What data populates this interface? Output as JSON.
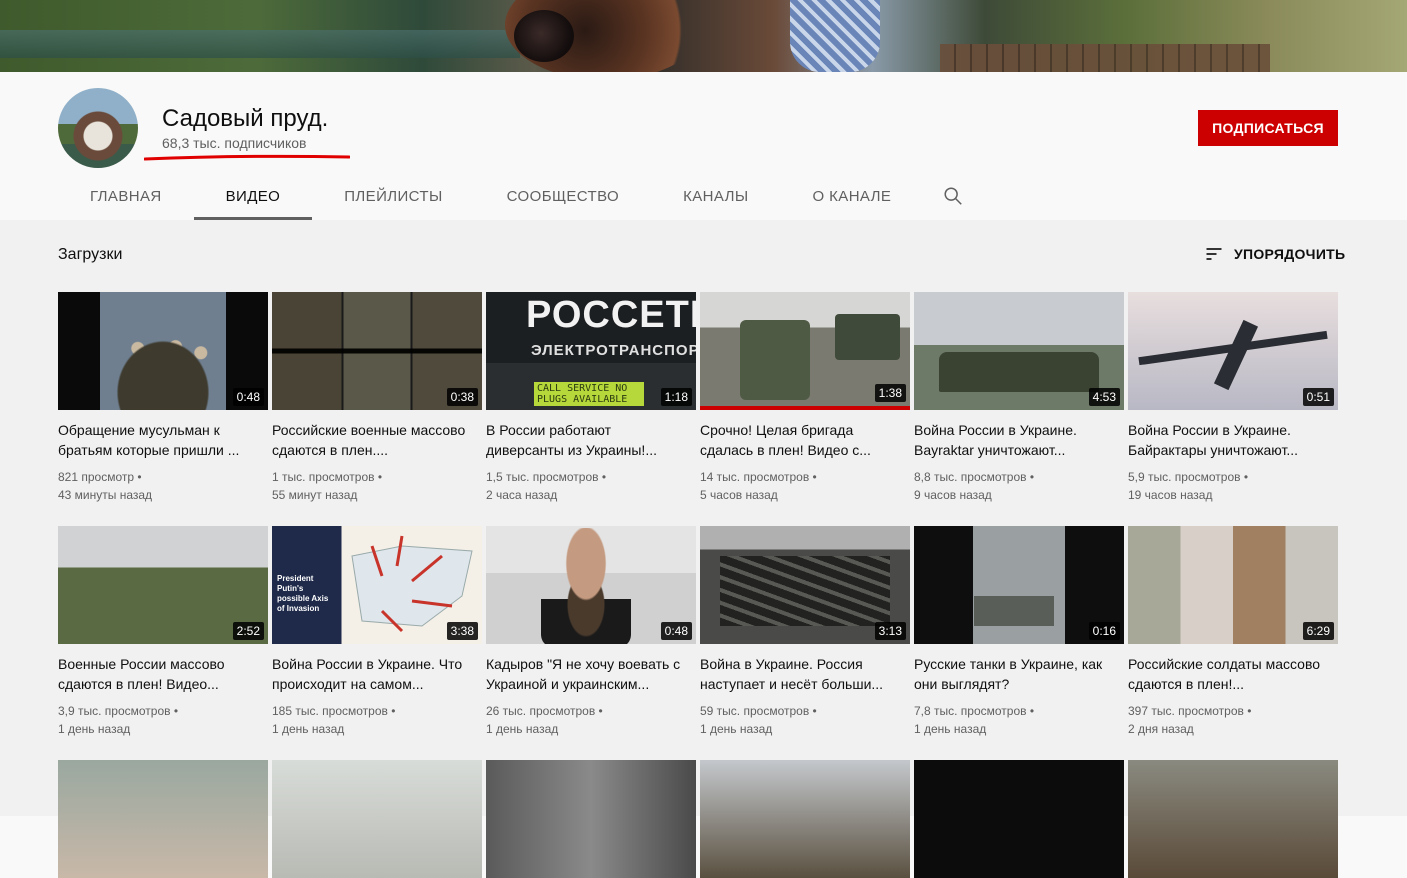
{
  "channel": {
    "name": "Садовый пруд.",
    "subscribers": "68,3 тыс. подписчиков",
    "subscribe_label": "ПОДПИСАТЬСЯ",
    "accent_color": "#cc0000"
  },
  "tabs": [
    {
      "label": "ГЛАВНАЯ"
    },
    {
      "label": "ВИДЕО",
      "active": true
    },
    {
      "label": "ПЛЕЙЛИСТЫ"
    },
    {
      "label": "СООБЩЕСТВО"
    },
    {
      "label": "КАНАЛЫ"
    },
    {
      "label": "О КАНАЛЕ"
    }
  ],
  "section": {
    "title": "Загрузки",
    "sort_label": "УПОРЯДОЧИТЬ"
  },
  "thumb_text": {
    "v3_big": "РОССЕТИ",
    "v3_small": "ЭЛЕКТРОТРАНСПОРТ",
    "v3_lcd": "CALL SERVICE NO PLUGS AVAILABLE",
    "v8_label": "President Putin's possible Axis of Invasion"
  },
  "videos": [
    {
      "title": "Обращение мусульман к братьям которые пришли ...",
      "duration": "0:48",
      "views": "821 просмотр •",
      "age": "43 минуты назад"
    },
    {
      "title": "Российские военные массово сдаются в плен....",
      "duration": "0:38",
      "views": "1 тыс. просмотров •",
      "age": "55 минут назад"
    },
    {
      "title": "В России работают диверсанты из Украины!...",
      "duration": "1:18",
      "views": "1,5 тыс. просмотров •",
      "age": "2 часа назад"
    },
    {
      "title": "Срочно! Целая бригада сдалась в плен! Видео с...",
      "duration": "1:38",
      "views": "14 тыс. просмотров •",
      "age": "5 часов назад",
      "watched_fraction": 1.0
    },
    {
      "title": "Война России в Украине. Bayraktar уничтожают...",
      "duration": "4:53",
      "views": "8,8 тыс. просмотров •",
      "age": "9 часов назад"
    },
    {
      "title": "Война России в Украине. Байрактары уничтожают...",
      "duration": "0:51",
      "views": "5,9 тыс. просмотров •",
      "age": "19 часов назад"
    },
    {
      "title": "Военные России массово сдаются в плен! Видео...",
      "duration": "2:52",
      "views": "3,9 тыс. просмотров •",
      "age": "1 день назад"
    },
    {
      "title": "Война России в Украине. Что происходит на самом...",
      "duration": "3:38",
      "views": "185 тыс. просмотров •",
      "age": "1 день назад"
    },
    {
      "title": "Кадыров \"Я не хочу воевать с Украиной и украинским...",
      "duration": "0:48",
      "views": "26 тыс. просмотров •",
      "age": "1 день назад"
    },
    {
      "title": "Война в Украине. Россия наступает и несёт больши...",
      "duration": "3:13",
      "views": "59 тыс. просмотров •",
      "age": "1 день назад"
    },
    {
      "title": "Русские танки в Украине, как они выглядят?",
      "duration": "0:16",
      "views": "7,8 тыс. просмотров •",
      "age": "1 день назад"
    },
    {
      "title": "Российские солдаты массово сдаются в плен!...",
      "duration": "6:29",
      "views": "397 тыс. просмотров •",
      "age": "2 дня назад"
    }
  ]
}
